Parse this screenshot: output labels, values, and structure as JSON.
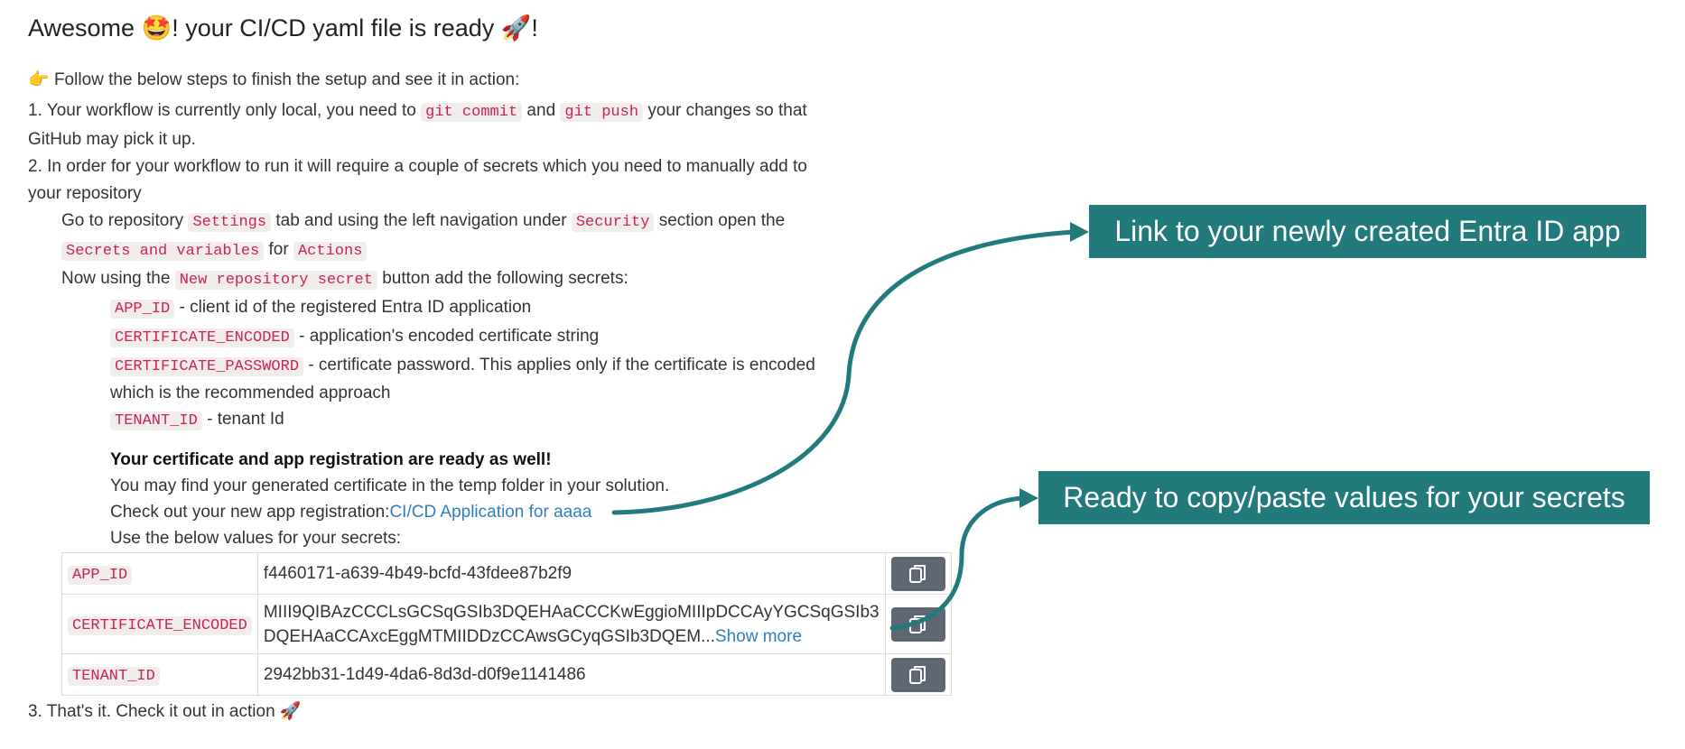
{
  "header": {
    "title_pre": "Awesome ",
    "title_emoji": "🤩",
    "title_mid": "! your CI/CD yaml file is ready ",
    "title_rocket": "🚀",
    "title_end": "!"
  },
  "intro": {
    "emoji": "👉",
    "text": "Follow the below steps to finish the setup and see it in action:"
  },
  "step1": {
    "prefix": "1. Your workflow is currently only local, you need to ",
    "code1": "git commit",
    "mid": " and ",
    "code2": "git push",
    "suffix": " your changes so that",
    "line2": "GitHub may pick it up."
  },
  "step2": {
    "line1": "2. In order for your workflow to run it will require a couple of secrets which you need to manually add to",
    "line2": "your repository",
    "nav_prefix": "Go to repository ",
    "nav_code1": "Settings",
    "nav_mid": " tab and using the left navigation under ",
    "nav_code2": "Security",
    "nav_suffix": " section open the",
    "nav2_code1": "Secrets and variables",
    "nav2_mid": " for ",
    "nav2_code2": "Actions",
    "btn_prefix": "Now using the ",
    "btn_code": "New repository secret",
    "btn_suffix": " button add the following secrets:",
    "secrets": [
      {
        "code": "APP_ID",
        "desc": " - client id of the registered Entra ID application"
      },
      {
        "code": "CERTIFICATE_ENCODED",
        "desc": " - application's encoded certificate string"
      },
      {
        "code": "CERTIFICATE_PASSWORD",
        "desc": " - certificate password. This applies only if the certificate is encoded"
      },
      {
        "code": "TENANT_ID",
        "desc": " - tenant Id"
      }
    ],
    "password_line2": "which is the recommended approach"
  },
  "ready": {
    "heading": "Your certificate and app registration are ready as well!",
    "temp_folder": "You may find your generated certificate in the temp folder in your solution.",
    "app_reg_prefix": "Check out your new app registration:",
    "app_reg_link": "CI/CD Application for aaaa",
    "use_values": "Use the below values for your secrets:"
  },
  "table": {
    "rows": [
      {
        "name": "APP_ID",
        "value": "f4460171-a639-4b49-bcfd-43fdee87b2f9"
      },
      {
        "name": "CERTIFICATE_ENCODED",
        "value_line1": "MIII9QIBAzCCCLsGCSqGSIb3DQEHAaCCCKwEggioMIIIpDCCAyYGCSqGSIb3",
        "value_line2": "DQEHAaCCAxcEggMTMIIDDzCCAwsGCyqGSIb3DQEM...",
        "show_more": "Show more"
      },
      {
        "name": "TENANT_ID",
        "value": "2942bb31-1d49-4da6-8d3d-d0f9e1141486"
      }
    ]
  },
  "step3": {
    "text": "3. That's it. Check it out in action ",
    "emoji": "🚀"
  },
  "callouts": {
    "entra_link": "Link to your newly created Entra ID app",
    "copy_values": "Ready to copy/paste values for your secrets"
  },
  "colors": {
    "accent": "#227a7c",
    "code_text": "#c7254e",
    "code_bg": "#f1eded",
    "link": "#2f7fbf",
    "copy_button": "#606774"
  },
  "icons": {
    "copy": "copy-icon"
  }
}
